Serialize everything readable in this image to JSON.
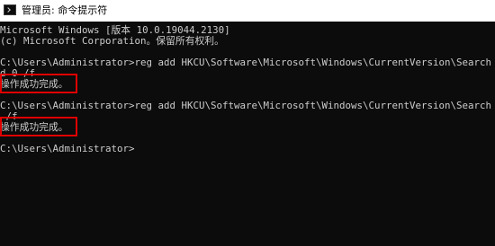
{
  "window": {
    "title": "管理员: 命令提示符",
    "icon": "cmd-console-icon"
  },
  "console": {
    "lines": [
      "Microsoft Windows [版本 10.0.19044.2130]",
      "(c) Microsoft Corporation。保留所有权利。",
      "",
      "C:\\Users\\Administrator>reg add HKCU\\Software\\Microsoft\\Windows\\CurrentVersion\\Search /v",
      "d 0 /f",
      "操作成功完成。",
      "",
      "C:\\Users\\Administrator>reg add HKCU\\Software\\Microsoft\\Windows\\CurrentVersion\\Search /v",
      " /f",
      "操作成功完成。",
      "",
      "C:\\Users\\Administrator>"
    ]
  },
  "annotations": {
    "highlight_color": "#e00000"
  },
  "colors": {
    "background": "#0c0c0c",
    "text": "#cccccc",
    "titlebar": "#ffffff"
  }
}
